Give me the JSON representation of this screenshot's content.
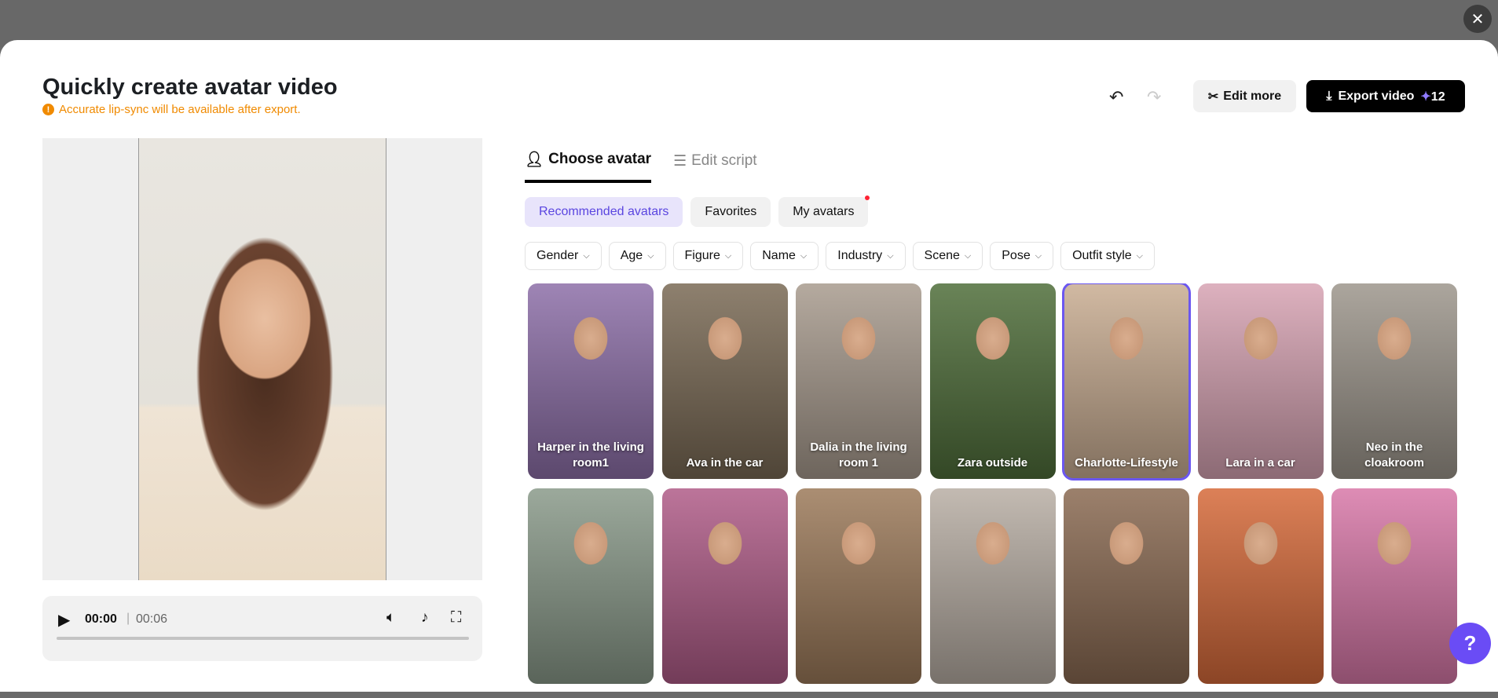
{
  "header": {
    "title": "Quickly create avatar video",
    "warning": "Accurate lip-sync will be available after export.",
    "edit_more": "Edit more",
    "export": "Export video",
    "credits": "12"
  },
  "player": {
    "current": "00:00",
    "separator": "|",
    "duration": "00:06",
    "progress": 0
  },
  "tabs": [
    {
      "label": "Choose avatar"
    },
    {
      "label": "Edit script"
    }
  ],
  "categories": [
    {
      "label": "Recommended avatars"
    },
    {
      "label": "Favorites"
    },
    {
      "label": "My avatars"
    }
  ],
  "filters": [
    "Gender",
    "Age",
    "Figure",
    "Name",
    "Industry",
    "Scene",
    "Pose",
    "Outfit style"
  ],
  "avatars": [
    {
      "label": "Harper in the living room1",
      "color": "#8d6fa8"
    },
    {
      "label": "Ava in the car",
      "color": "#7a6a55"
    },
    {
      "label": "Dalia in the living room 1",
      "color": "#a89b8e"
    },
    {
      "label": "Zara outside",
      "color": "#4f6e3a"
    },
    {
      "label": "Charlotte-Lifestyle",
      "color": "#c9ad92",
      "selected": true
    },
    {
      "label": "Lara in a car",
      "color": "#d7a3b3"
    },
    {
      "label": "Neo in the cloakroom",
      "color": "#9d968c"
    },
    {
      "label": "",
      "color": "#8a9a8a"
    },
    {
      "label": "",
      "color": "#b05c88"
    },
    {
      "label": "",
      "color": "#9c7a5a"
    },
    {
      "label": "",
      "color": "#b8aea4"
    },
    {
      "label": "",
      "color": "#8a6a52"
    },
    {
      "label": "",
      "color": "#d66a3a"
    },
    {
      "label": "",
      "color": "#d878a8"
    }
  ],
  "icons": {
    "close": "close-icon",
    "help": "help-icon"
  }
}
